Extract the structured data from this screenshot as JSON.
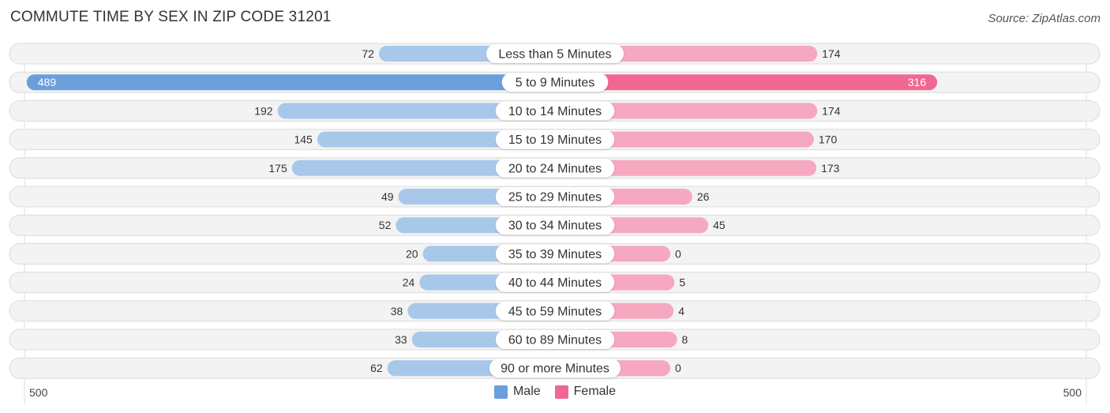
{
  "title": "COMMUTE TIME BY SEX IN ZIP CODE 31201",
  "source": "Source: ZipAtlas.com",
  "legend": [
    {
      "label": "Male",
      "color": "#6a9fdb"
    },
    {
      "label": "Female",
      "color": "#f06892"
    }
  ],
  "axis": {
    "left_label": "500",
    "right_label": "500"
  },
  "chart_data": {
    "type": "bar",
    "orientation": "horizontal-diverging",
    "title": "COMMUTE TIME BY SEX IN ZIP CODE 31201",
    "categories": [
      "Less than 5 Minutes",
      "5 to 9 Minutes",
      "10 to 14 Minutes",
      "15 to 19 Minutes",
      "20 to 24 Minutes",
      "25 to 29 Minutes",
      "30 to 34 Minutes",
      "35 to 39 Minutes",
      "40 to 44 Minutes",
      "45 to 59 Minutes",
      "60 to 89 Minutes",
      "90 or more Minutes"
    ],
    "series": [
      {
        "name": "Male",
        "color": "#6a9fdb",
        "light_color": "#a8c8ea",
        "values": [
          72,
          489,
          192,
          145,
          175,
          49,
          52,
          20,
          24,
          38,
          33,
          62
        ]
      },
      {
        "name": "Female",
        "color": "#f06892",
        "light_color": "#f5a8c0",
        "values": [
          174,
          316,
          174,
          170,
          173,
          26,
          45,
          0,
          5,
          4,
          8,
          0
        ]
      }
    ],
    "xlim": [
      -500,
      500
    ],
    "xtick_labels": [
      "500",
      "500"
    ],
    "legend_position": "bottom-center",
    "grid": false
  }
}
